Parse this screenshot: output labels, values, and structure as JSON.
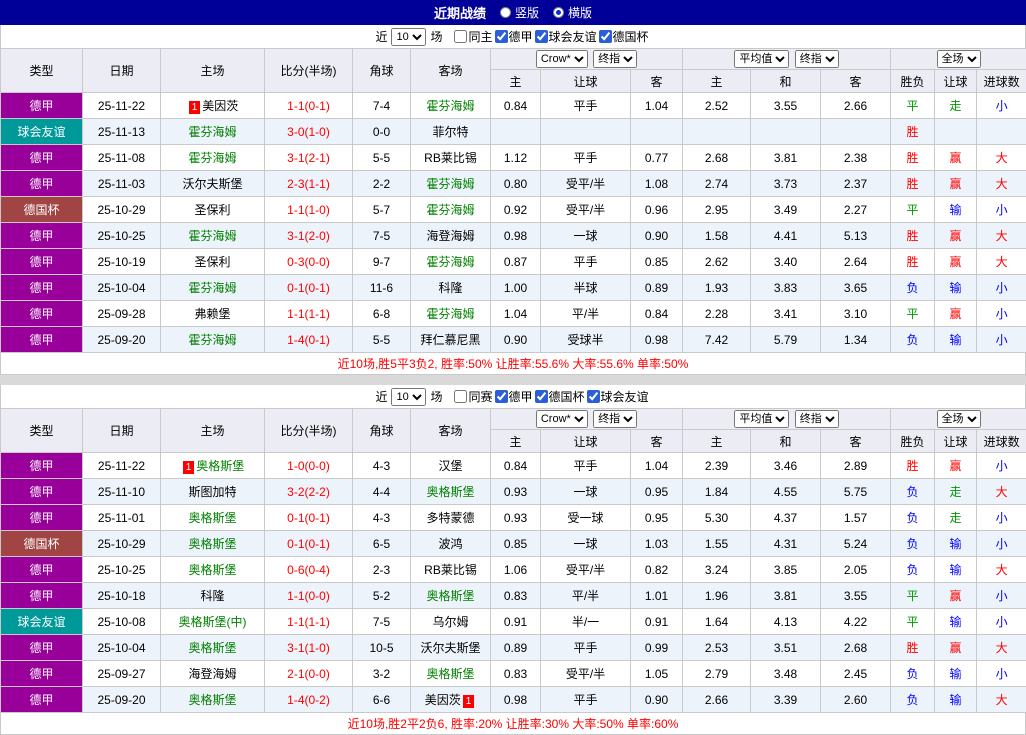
{
  "topbar": {
    "title": "近期战绩",
    "view_options": [
      {
        "label": "竖版",
        "selected": false
      },
      {
        "label": "横版",
        "selected": true
      }
    ]
  },
  "colors": {
    "topbar_bg": "#000099",
    "header_bg": "#ECECF4",
    "alt_row_bg": "#EDF3FB",
    "focus_team": "#008000",
    "score_red": "#FF0000",
    "summary_text": "#FF0000",
    "type_colors": {
      "德甲": "#990099",
      "球会友谊": "#009999",
      "德国杯": "#A04444"
    },
    "result_colors": {
      "win": "#FF0000",
      "draw": "#009900",
      "lose": "#0000FF"
    }
  },
  "sections": [
    {
      "focus_team": "霍芬海姆",
      "filter": {
        "prefix": "近",
        "count": "10",
        "suffix": "场",
        "checkboxes": [
          {
            "label": "同主",
            "checked": false
          },
          {
            "label": "德甲",
            "checked": true
          },
          {
            "label": "球会友谊",
            "checked": true
          },
          {
            "label": "德国杯",
            "checked": true
          }
        ]
      },
      "header": {
        "type": "类型",
        "date": "日期",
        "home": "主场",
        "score": "比分(半场)",
        "corner": "角球",
        "away": "客场",
        "handicap_selects": [
          "Crow*",
          "终指"
        ],
        "avg_selects": [
          "平均值",
          "终指"
        ],
        "fulltime_select": "全场",
        "sub": [
          "主",
          "让球",
          "客",
          "主",
          "和",
          "客",
          "胜负",
          "让球",
          "进球数"
        ]
      },
      "rows": [
        {
          "type": "德甲",
          "date": "25-11-22",
          "home": {
            "name": "美因茨",
            "badge_before": "1"
          },
          "score": "1-1(0-1)",
          "corners": "7-4",
          "away": {
            "name": "霍芬海姆",
            "focus": true
          },
          "odds": [
            "0.84",
            "平手",
            "1.04",
            "2.52",
            "3.55",
            "2.66"
          ],
          "results": [
            {
              "t": "平",
              "c": "draw"
            },
            {
              "t": "走",
              "c": "draw"
            },
            {
              "t": "小",
              "c": "lose"
            }
          ]
        },
        {
          "type": "球会友谊",
          "date": "25-11-13",
          "home": {
            "name": "霍芬海姆",
            "focus": true
          },
          "score": "3-0(1-0)",
          "corners": "0-0",
          "away": {
            "name": "菲尔特"
          },
          "odds": [
            "",
            "",
            "",
            "",
            "",
            ""
          ],
          "results": [
            {
              "t": "胜",
              "c": "win"
            },
            {
              "t": "",
              "c": ""
            },
            {
              "t": "",
              "c": ""
            }
          ]
        },
        {
          "type": "德甲",
          "date": "25-11-08",
          "home": {
            "name": "霍芬海姆",
            "focus": true
          },
          "score": "3-1(2-1)",
          "corners": "5-5",
          "away": {
            "name": "RB莱比锡"
          },
          "odds": [
            "1.12",
            "平手",
            "0.77",
            "2.68",
            "3.81",
            "2.38"
          ],
          "results": [
            {
              "t": "胜",
              "c": "win"
            },
            {
              "t": "赢",
              "c": "win"
            },
            {
              "t": "大",
              "c": "win"
            }
          ]
        },
        {
          "type": "德甲",
          "date": "25-11-03",
          "home": {
            "name": "沃尔夫斯堡"
          },
          "score": "2-3(1-1)",
          "corners": "2-2",
          "away": {
            "name": "霍芬海姆",
            "focus": true
          },
          "odds": [
            "0.80",
            "受平/半",
            "1.08",
            "2.74",
            "3.73",
            "2.37"
          ],
          "results": [
            {
              "t": "胜",
              "c": "win"
            },
            {
              "t": "赢",
              "c": "win"
            },
            {
              "t": "大",
              "c": "win"
            }
          ]
        },
        {
          "type": "德国杯",
          "date": "25-10-29",
          "home": {
            "name": "圣保利"
          },
          "score": "1-1(1-0)",
          "corners": "5-7",
          "away": {
            "name": "霍芬海姆",
            "focus": true
          },
          "odds": [
            "0.92",
            "受平/半",
            "0.96",
            "2.95",
            "3.49",
            "2.27"
          ],
          "results": [
            {
              "t": "平",
              "c": "draw"
            },
            {
              "t": "输",
              "c": "lose"
            },
            {
              "t": "小",
              "c": "lose"
            }
          ]
        },
        {
          "type": "德甲",
          "date": "25-10-25",
          "home": {
            "name": "霍芬海姆",
            "focus": true
          },
          "score": "3-1(2-0)",
          "corners": "7-5",
          "away": {
            "name": "海登海姆"
          },
          "odds": [
            "0.98",
            "一球",
            "0.90",
            "1.58",
            "4.41",
            "5.13"
          ],
          "results": [
            {
              "t": "胜",
              "c": "win"
            },
            {
              "t": "赢",
              "c": "win"
            },
            {
              "t": "大",
              "c": "win"
            }
          ]
        },
        {
          "type": "德甲",
          "date": "25-10-19",
          "home": {
            "name": "圣保利"
          },
          "score": "0-3(0-0)",
          "corners": "9-7",
          "away": {
            "name": "霍芬海姆",
            "focus": true
          },
          "odds": [
            "0.87",
            "平手",
            "0.85",
            "2.62",
            "3.40",
            "2.64"
          ],
          "results": [
            {
              "t": "胜",
              "c": "win"
            },
            {
              "t": "赢",
              "c": "win"
            },
            {
              "t": "大",
              "c": "win"
            }
          ]
        },
        {
          "type": "德甲",
          "date": "25-10-04",
          "home": {
            "name": "霍芬海姆",
            "focus": true
          },
          "score": "0-1(0-1)",
          "corners": "11-6",
          "away": {
            "name": "科隆"
          },
          "odds": [
            "1.00",
            "半球",
            "0.89",
            "1.93",
            "3.83",
            "3.65"
          ],
          "results": [
            {
              "t": "负",
              "c": "lose"
            },
            {
              "t": "输",
              "c": "lose"
            },
            {
              "t": "小",
              "c": "lose"
            }
          ]
        },
        {
          "type": "德甲",
          "date": "25-09-28",
          "home": {
            "name": "弗赖堡"
          },
          "score": "1-1(1-1)",
          "corners": "6-8",
          "away": {
            "name": "霍芬海姆",
            "focus": true
          },
          "odds": [
            "1.04",
            "平/半",
            "0.84",
            "2.28",
            "3.41",
            "3.10"
          ],
          "results": [
            {
              "t": "平",
              "c": "draw"
            },
            {
              "t": "赢",
              "c": "win"
            },
            {
              "t": "小",
              "c": "lose"
            }
          ]
        },
        {
          "type": "德甲",
          "date": "25-09-20",
          "home": {
            "name": "霍芬海姆",
            "focus": true
          },
          "score": "1-4(0-1)",
          "corners": "5-5",
          "away": {
            "name": "拜仁慕尼黑"
          },
          "odds": [
            "0.90",
            "受球半",
            "0.98",
            "7.42",
            "5.79",
            "1.34"
          ],
          "results": [
            {
              "t": "负",
              "c": "lose"
            },
            {
              "t": "输",
              "c": "lose"
            },
            {
              "t": "小",
              "c": "lose"
            }
          ]
        }
      ],
      "summary": "近10场,胜5平3负2, 胜率:50% 让胜率:55.6% 大率:55.6% 单率:50%"
    },
    {
      "focus_team": "奥格斯堡",
      "filter": {
        "prefix": "近",
        "count": "10",
        "suffix": "场",
        "checkboxes": [
          {
            "label": "同赛",
            "checked": false
          },
          {
            "label": "德甲",
            "checked": true
          },
          {
            "label": "德国杯",
            "checked": true
          },
          {
            "label": "球会友谊",
            "checked": true
          }
        ]
      },
      "header": {
        "type": "类型",
        "date": "日期",
        "home": "主场",
        "score": "比分(半场)",
        "corner": "角球",
        "away": "客场",
        "handicap_selects": [
          "Crow*",
          "终指"
        ],
        "avg_selects": [
          "平均值",
          "终指"
        ],
        "fulltime_select": "全场",
        "sub": [
          "主",
          "让球",
          "客",
          "主",
          "和",
          "客",
          "胜负",
          "让球",
          "进球数"
        ]
      },
      "rows": [
        {
          "type": "德甲",
          "date": "25-11-22",
          "home": {
            "name": "奥格斯堡",
            "badge_before": "1",
            "focus": true
          },
          "score": "1-0(0-0)",
          "corners": "4-3",
          "away": {
            "name": "汉堡"
          },
          "odds": [
            "0.84",
            "平手",
            "1.04",
            "2.39",
            "3.46",
            "2.89"
          ],
          "results": [
            {
              "t": "胜",
              "c": "win"
            },
            {
              "t": "赢",
              "c": "win"
            },
            {
              "t": "小",
              "c": "lose"
            }
          ]
        },
        {
          "type": "德甲",
          "date": "25-11-10",
          "home": {
            "name": "斯图加特"
          },
          "score": "3-2(2-2)",
          "corners": "4-4",
          "away": {
            "name": "奥格斯堡",
            "focus": true
          },
          "odds": [
            "0.93",
            "一球",
            "0.95",
            "1.84",
            "4.55",
            "5.75"
          ],
          "results": [
            {
              "t": "负",
              "c": "lose"
            },
            {
              "t": "走",
              "c": "draw"
            },
            {
              "t": "大",
              "c": "win"
            }
          ]
        },
        {
          "type": "德甲",
          "date": "25-11-01",
          "home": {
            "name": "奥格斯堡",
            "focus": true
          },
          "score": "0-1(0-1)",
          "corners": "4-3",
          "away": {
            "name": "多特蒙德"
          },
          "odds": [
            "0.93",
            "受一球",
            "0.95",
            "5.30",
            "4.37",
            "1.57"
          ],
          "results": [
            {
              "t": "负",
              "c": "lose"
            },
            {
              "t": "走",
              "c": "draw"
            },
            {
              "t": "小",
              "c": "lose"
            }
          ]
        },
        {
          "type": "德国杯",
          "date": "25-10-29",
          "home": {
            "name": "奥格斯堡",
            "focus": true
          },
          "score": "0-1(0-1)",
          "corners": "6-5",
          "away": {
            "name": "波鸿"
          },
          "odds": [
            "0.85",
            "一球",
            "1.03",
            "1.55",
            "4.31",
            "5.24"
          ],
          "results": [
            {
              "t": "负",
              "c": "lose"
            },
            {
              "t": "输",
              "c": "lose"
            },
            {
              "t": "小",
              "c": "lose"
            }
          ]
        },
        {
          "type": "德甲",
          "date": "25-10-25",
          "home": {
            "name": "奥格斯堡",
            "focus": true
          },
          "score": "0-6(0-4)",
          "corners": "2-3",
          "away": {
            "name": "RB莱比锡"
          },
          "odds": [
            "1.06",
            "受平/半",
            "0.82",
            "3.24",
            "3.85",
            "2.05"
          ],
          "results": [
            {
              "t": "负",
              "c": "lose"
            },
            {
              "t": "输",
              "c": "lose"
            },
            {
              "t": "大",
              "c": "win"
            }
          ]
        },
        {
          "type": "德甲",
          "date": "25-10-18",
          "home": {
            "name": "科隆"
          },
          "score": "1-1(0-0)",
          "corners": "5-2",
          "away": {
            "name": "奥格斯堡",
            "focus": true
          },
          "odds": [
            "0.83",
            "平/半",
            "1.01",
            "1.96",
            "3.81",
            "3.55"
          ],
          "results": [
            {
              "t": "平",
              "c": "draw"
            },
            {
              "t": "赢",
              "c": "win"
            },
            {
              "t": "小",
              "c": "lose"
            }
          ]
        },
        {
          "type": "球会友谊",
          "date": "25-10-08",
          "home": {
            "name": "奥格斯堡(中)",
            "focus": true
          },
          "score": "1-1(1-1)",
          "corners": "7-5",
          "away": {
            "name": "乌尔姆"
          },
          "odds": [
            "0.91",
            "半/一",
            "0.91",
            "1.64",
            "4.13",
            "4.22"
          ],
          "results": [
            {
              "t": "平",
              "c": "draw"
            },
            {
              "t": "输",
              "c": "lose"
            },
            {
              "t": "小",
              "c": "lose"
            }
          ]
        },
        {
          "type": "德甲",
          "date": "25-10-04",
          "home": {
            "name": "奥格斯堡",
            "focus": true
          },
          "score": "3-1(1-0)",
          "corners": "10-5",
          "away": {
            "name": "沃尔夫斯堡"
          },
          "odds": [
            "0.89",
            "平手",
            "0.99",
            "2.53",
            "3.51",
            "2.68"
          ],
          "results": [
            {
              "t": "胜",
              "c": "win"
            },
            {
              "t": "赢",
              "c": "win"
            },
            {
              "t": "大",
              "c": "win"
            }
          ]
        },
        {
          "type": "德甲",
          "date": "25-09-27",
          "home": {
            "name": "海登海姆"
          },
          "score": "2-1(0-0)",
          "corners": "3-2",
          "away": {
            "name": "奥格斯堡",
            "focus": true
          },
          "odds": [
            "0.83",
            "受平/半",
            "1.05",
            "2.79",
            "3.48",
            "2.45"
          ],
          "results": [
            {
              "t": "负",
              "c": "lose"
            },
            {
              "t": "输",
              "c": "lose"
            },
            {
              "t": "小",
              "c": "lose"
            }
          ]
        },
        {
          "type": "德甲",
          "date": "25-09-20",
          "home": {
            "name": "奥格斯堡",
            "focus": true
          },
          "score": "1-4(0-2)",
          "corners": "6-6",
          "away": {
            "name": "美因茨",
            "badge_after": "1"
          },
          "odds": [
            "0.98",
            "平手",
            "0.90",
            "2.66",
            "3.39",
            "2.60"
          ],
          "results": [
            {
              "t": "负",
              "c": "lose"
            },
            {
              "t": "输",
              "c": "lose"
            },
            {
              "t": "大",
              "c": "win"
            }
          ]
        }
      ],
      "summary": "近10场,胜2平2负6, 胜率:20% 让胜率:30% 大率:50% 单率:60%"
    }
  ]
}
